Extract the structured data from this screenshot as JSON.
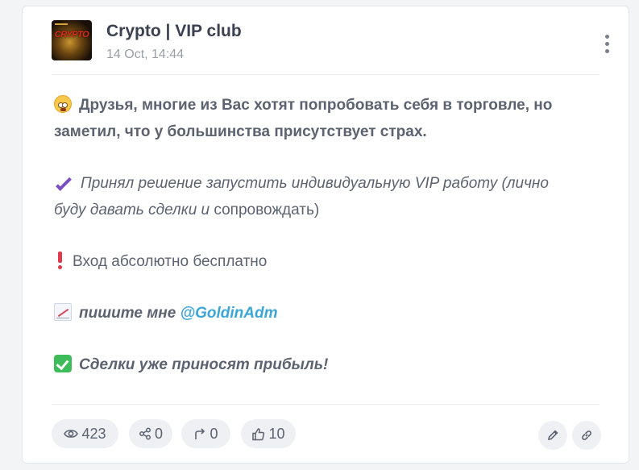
{
  "channel": {
    "title": "Crypto | VIP club",
    "date": "14 Oct, 14:44",
    "avatar_text": "CRYPTO"
  },
  "post": {
    "line1_a": "Друзья, многие из Вас хотят попробовать себя в торговле, но",
    "line1_b": "заметил, что у большинства присутствует страх.",
    "line2_a": "Принял решение запустить индивидуальную VIP работу (лично",
    "line2_b_italic": "буду давать сделки и",
    "line2_b_plain": " сопровождать)",
    "line3": "Вход абсолютно бесплатно",
    "line4_text": "пишите мне ",
    "line4_link": "@GoldinAdm",
    "line5": "Сделки уже приносят прибыль!"
  },
  "icons": {
    "line1": "astonished-face-emoji",
    "line2": "heavy-check-mark-emoji",
    "line3": "exclamation-emoji",
    "line4": "chart-increasing-emoji",
    "line5": "check-box-emoji"
  },
  "stats": {
    "views": "423",
    "shares": "0",
    "forwards": "0",
    "likes": "10"
  },
  "colors": {
    "link": "#3aa7d8",
    "pill_bg": "#eef0f3",
    "title": "#3b4150"
  }
}
